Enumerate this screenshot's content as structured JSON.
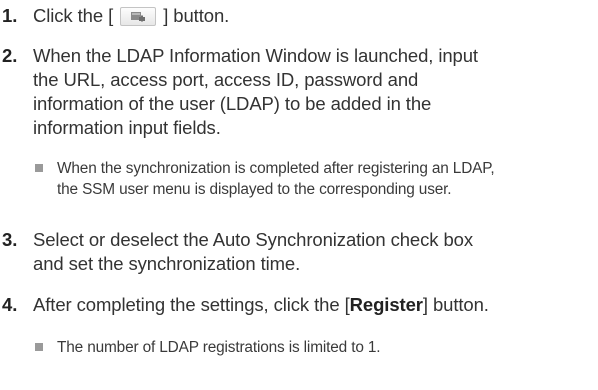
{
  "steps": [
    {
      "number": "1.",
      "text_before": "Click the [",
      "button_icon": "add-ldap-icon",
      "text_after": "] button."
    },
    {
      "number": "2.",
      "lines": [
        "When the LDAP Information Window is launched, input",
        "the URL, access port, access ID, password and",
        "information of the user (LDAP) to be added in the",
        "information input fields."
      ]
    },
    {
      "number": "3.",
      "lines": [
        "Select or deselect the Auto Synchronization check box",
        "and set the synchronization time."
      ]
    },
    {
      "number": "4.",
      "text_before": "After completing the settings, click the [",
      "bold": "Register",
      "text_after": "] button."
    }
  ],
  "notes": [
    {
      "lines": [
        "When the synchronization is completed after registering an LDAP,",
        "the SSM user menu is displayed to the corresponding user."
      ]
    },
    {
      "lines": [
        "The number of LDAP registrations is limited to 1."
      ]
    }
  ],
  "colors": {
    "text": "#333333",
    "bullet": "#9a9a9a"
  }
}
